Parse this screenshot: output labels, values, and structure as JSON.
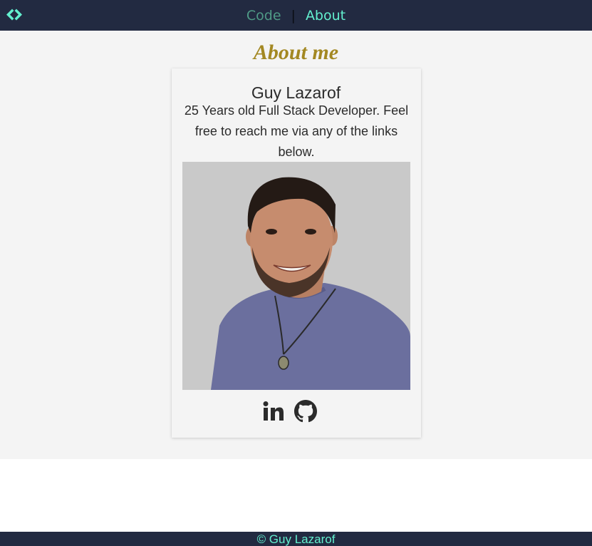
{
  "nav": {
    "links": [
      {
        "label": "Code",
        "active": false
      },
      {
        "label": "About",
        "active": true
      }
    ],
    "separator": "|",
    "logo_icon": "code-brackets-icon"
  },
  "colors": {
    "navbar_bg": "#222a41",
    "accent": "#63f0cf",
    "inactive_link": "#4f9a86",
    "title_gold": "#a38822",
    "page_bg": "#f4f4f4"
  },
  "about": {
    "title": "About me",
    "name": "Guy Lazarof",
    "description": "25 Years old Full Stack Developer. Feel free to reach me via any of the links below.",
    "photo_icon": "profile-photo",
    "social": [
      {
        "name": "LinkedIn",
        "icon": "linkedin-icon"
      },
      {
        "name": "GitHub",
        "icon": "github-icon"
      }
    ]
  },
  "footer": {
    "text": "© Guy Lazarof"
  }
}
